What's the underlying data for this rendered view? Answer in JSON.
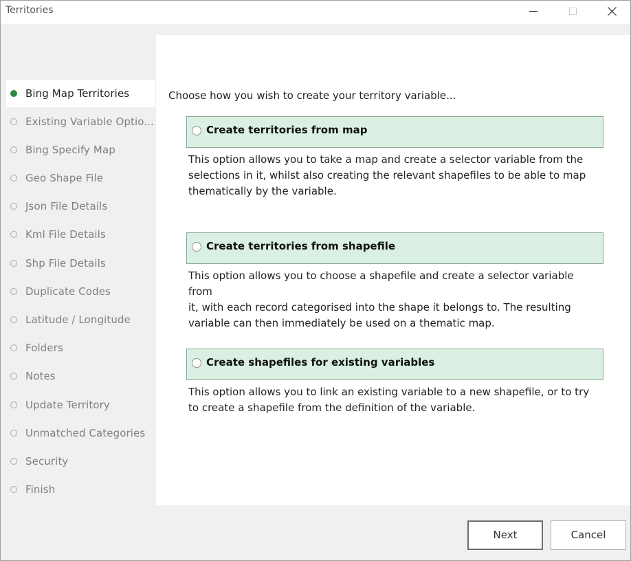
{
  "window": {
    "title": "Territories"
  },
  "sidebar": {
    "items": [
      {
        "label": "Bing Map Territories",
        "active": true
      },
      {
        "label": "Existing Variable Optio..."
      },
      {
        "label": "Bing Specify Map"
      },
      {
        "label": "Geo Shape File"
      },
      {
        "label": "Json File Details"
      },
      {
        "label": "Kml File Details"
      },
      {
        "label": "Shp File Details"
      },
      {
        "label": "Duplicate Codes"
      },
      {
        "label": "Latitude / Longitude"
      },
      {
        "label": "Folders"
      },
      {
        "label": "Notes"
      },
      {
        "label": "Update Territory"
      },
      {
        "label": "Unmatched Categories"
      },
      {
        "label": "Security"
      },
      {
        "label": "Finish"
      }
    ]
  },
  "main": {
    "prompt": "Choose how you wish to create your territory variable...",
    "options": [
      {
        "label": "Create territories from map",
        "description_lines": [
          "This option allows you to take a map and create a selector variable from the",
          "selections in it, whilst also creating the relevant shapefiles to be able to map",
          "thematically by the variable."
        ]
      },
      {
        "label": "Create territories from shapefile",
        "description_lines": [
          "This option allows you to choose a shapefile and create a selector variable from",
          "it, with each record categorised into the shape it belongs to. The resulting",
          "variable can then immediately be used on a thematic map."
        ]
      },
      {
        "label": "Create shapefiles for existing variables",
        "description_lines": [
          "This option allows you to link an existing variable to a new shapefile, or to try",
          "to create a shapefile from the definition of the variable."
        ]
      }
    ]
  },
  "footer": {
    "next_label": "Next",
    "cancel_label": "Cancel"
  },
  "colors": {
    "active_dot": "#2e8b3e",
    "option_background": "#daf0e2"
  }
}
